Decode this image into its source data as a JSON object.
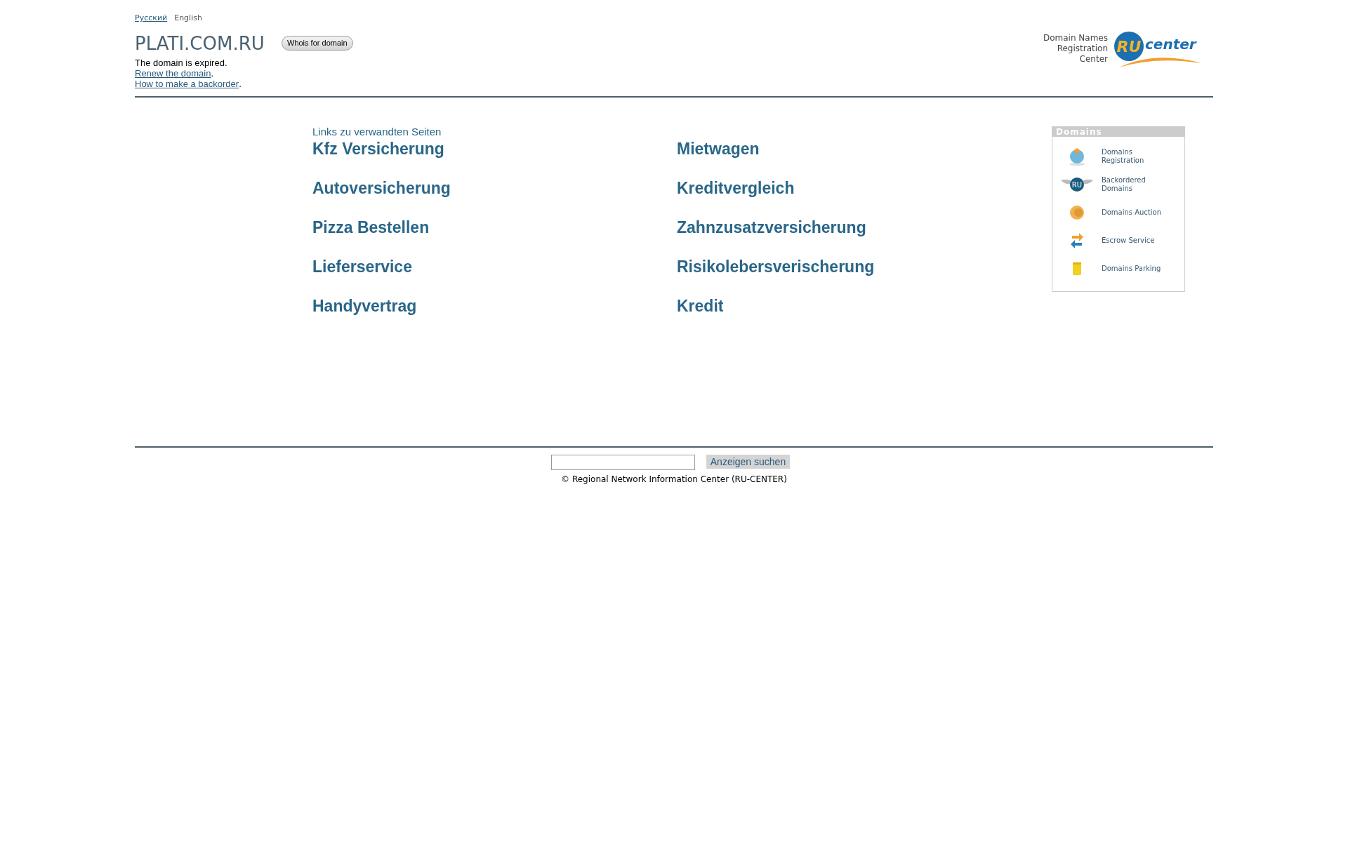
{
  "languages": [
    {
      "label": "Русский",
      "selected": false
    },
    {
      "label": "English",
      "selected": true
    }
  ],
  "domain": {
    "name": "PLATI.COM.RU",
    "whois_button": "Whois for domain",
    "status": "The domain is expired.",
    "links": [
      {
        "text": "Renew the domain",
        "after": "."
      },
      {
        "text": "How to make a backorder",
        "after": "."
      }
    ]
  },
  "logo": {
    "caption": [
      "Domain Names",
      "Registration",
      "Center"
    ],
    "mark": "RU",
    "word": "center"
  },
  "related": {
    "heading": "Links zu verwandten Seiten",
    "links": [
      "Kfz Versicherung",
      "Mietwagen",
      "Autoversicherung",
      "Kreditvergleich",
      "Pizza Bestellen",
      "Zahnzusatzversicherung",
      "Lieferservice",
      "Risikolebersverischerung",
      "Handyvertrag",
      "Kredit"
    ]
  },
  "sidebar": {
    "title": "Domains",
    "items": [
      {
        "label": "Domains Registration",
        "kind": "globe"
      },
      {
        "label": "Backordered Domains",
        "kind": "wings",
        "badge": "RU"
      },
      {
        "label": "Domains Auction",
        "kind": "coin"
      },
      {
        "label": "Escrow Service",
        "kind": "arrows"
      },
      {
        "label": "Domains Parking",
        "kind": "stack"
      }
    ]
  },
  "search": {
    "button": "Anzeigen suchen"
  },
  "footer": {
    "copyright": "© Regional Network Information Center (RU-CENTER)"
  }
}
